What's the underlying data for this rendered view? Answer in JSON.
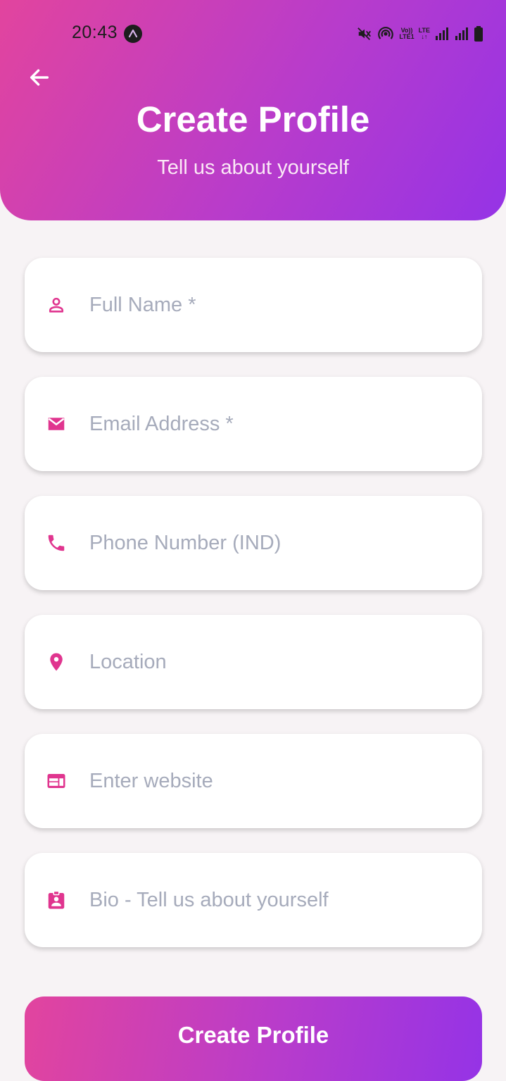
{
  "status_bar": {
    "time": "20:43",
    "app_icon": "expo-go-icon",
    "icons": [
      "mute-icon",
      "hotspot-icon",
      "volte-icon",
      "lte-icon",
      "signal-icon",
      "signal-icon",
      "battery-icon"
    ],
    "volte_label_top": "Vo))",
    "volte_label_bottom": "LTE1",
    "lte_label_top": "LTE",
    "lte_label_bottom": "↓↑"
  },
  "header": {
    "back_icon": "arrow-left-icon",
    "title": "Create Profile",
    "subtitle": "Tell us about yourself"
  },
  "form": {
    "full_name": {
      "placeholder": "Full Name *",
      "icon": "person-icon"
    },
    "email": {
      "placeholder": "Email Address *",
      "icon": "mail-icon"
    },
    "phone": {
      "placeholder": "Phone Number (IND)",
      "icon": "phone-icon"
    },
    "location": {
      "placeholder": "Location",
      "icon": "location-pin-icon"
    },
    "website": {
      "placeholder": "Enter website",
      "icon": "web-icon"
    },
    "bio": {
      "placeholder": "Bio - Tell us about yourself",
      "icon": "badge-icon"
    }
  },
  "submit": {
    "label": "Create Profile"
  },
  "colors": {
    "gradient_start": "#e2449e",
    "gradient_end": "#9533e6",
    "icon_accent": "#e0358f",
    "background": "#f7f3f5",
    "placeholder": "#a6abbb"
  }
}
